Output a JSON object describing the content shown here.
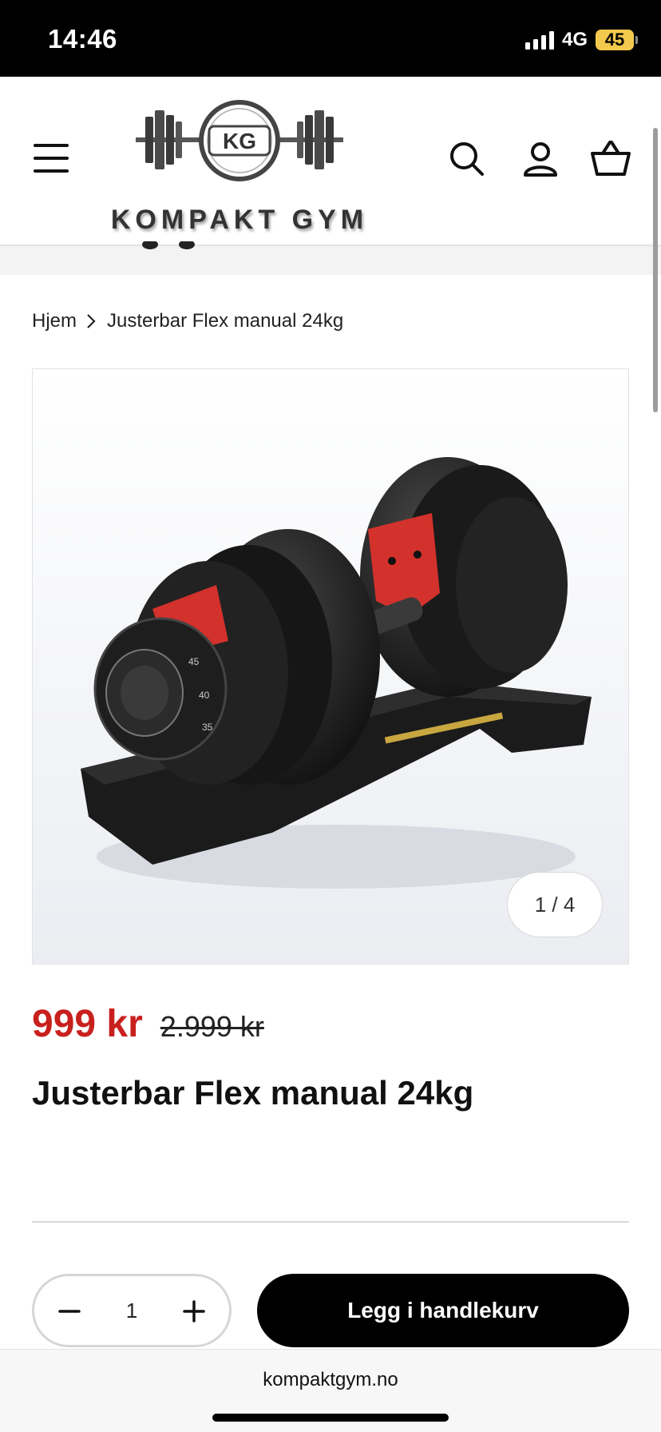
{
  "status_bar": {
    "time": "14:46",
    "network": "4G",
    "battery": "45"
  },
  "header": {
    "logo_text": "KOMPAKT GYM",
    "logo_initials": "KG",
    "icons": [
      "menu-icon",
      "search-icon",
      "account-icon",
      "cart-icon"
    ]
  },
  "breadcrumb": {
    "home": "Hjem",
    "current": "Justerbar Flex manual 24kg"
  },
  "product": {
    "image_counter": "1 / 4",
    "price_sale": "999 kr",
    "price_regular": "2.999 kr",
    "title": "Justerbar Flex manual 24kg",
    "sale_color": "#c8201e"
  },
  "purchase": {
    "quantity": "1",
    "add_to_cart_label": "Legg i handlekurv"
  },
  "browser": {
    "url": "kompaktgym.no"
  }
}
